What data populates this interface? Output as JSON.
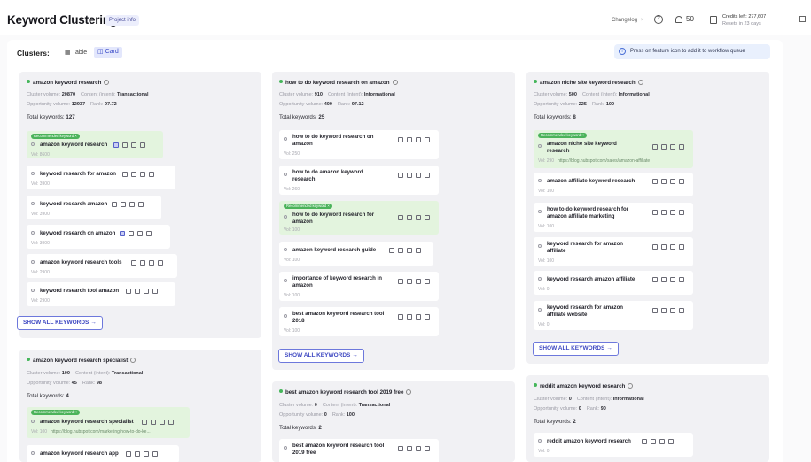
{
  "header": {
    "title": "Keyword Clustering",
    "project_chip": "Project info",
    "changelog": "Changelog",
    "changelog_close": "×",
    "notifications_count": "50",
    "credits_line": "Credits left: 277,607",
    "credits_reset": "Resets in 23 days"
  },
  "toolbar": {
    "clusters_label": "Clusters:",
    "view_table": "Table",
    "view_card": "Card",
    "info_banner": "Press on feature icon to add it to workflow queue"
  },
  "labels": {
    "cluster_volume": "Cluster volume:",
    "content_intent": "Content (intent):",
    "opportunity_volume": "Opportunity volume:",
    "rank": "Rank:",
    "total_keywords": "Total keywords:",
    "recommended": "Recommended keyword ×",
    "show_all": "SHOW ALL KEYWORDS →"
  },
  "clusters": [
    {
      "name": "amazon keyword research",
      "cluster_volume": "20870",
      "intent": "Transactional",
      "opportunity_volume": "12937",
      "rank": "97.72",
      "total": "127",
      "keywords": [
        {
          "name": "amazon keyword research",
          "vol": "Vol: 8600"
        },
        {
          "name": "keyword research for amazon",
          "vol": "Vol: 3900"
        },
        {
          "name": "keyword research amazon",
          "vol": "Vol: 3900"
        },
        {
          "name": "keyword research on amazon",
          "vol": "Vol: 3900"
        },
        {
          "name": "amazon keyword research tools",
          "vol": "Vol: 2900"
        },
        {
          "name": "keyword research tool amazon",
          "vol": "Vol: 2900"
        }
      ]
    },
    {
      "name": "how to do keyword research on amazon",
      "cluster_volume": "910",
      "intent": "Informational",
      "opportunity_volume": "409",
      "rank": "97.12",
      "total": "25",
      "keywords": [
        {
          "name": "how to do keyword research on amazon",
          "vol": "Vol: 250"
        },
        {
          "name": "how to do amazon keyword research",
          "vol": "Vol: 260"
        },
        {
          "name": "how to do keyword research for amazon",
          "vol": "Vol: 100"
        },
        {
          "name": "amazon keyword research guide",
          "vol": "Vol: 100"
        },
        {
          "name": "importance of keyword research in amazon",
          "vol": "Vol: 100"
        },
        {
          "name": "best amazon keyword research tool 2018",
          "vol": "Vol: 100"
        }
      ]
    },
    {
      "name": "amazon niche site keyword research",
      "cluster_volume": "500",
      "intent": "Informational",
      "opportunity_volume": "225",
      "rank": "100",
      "total": "8",
      "keywords": [
        {
          "name": "amazon niche site keyword research",
          "vol": "Vol: 290",
          "url": "https://blog.hubspot.com/sales/amazon-affiliate"
        },
        {
          "name": "amazon affiliate keyword research",
          "vol": "Vol: 100"
        },
        {
          "name": "how to do keyword research for amazon affiliate marketing",
          "vol": "Vol: 100"
        },
        {
          "name": "keyword research for amazon affiliate",
          "vol": "Vol: 100"
        },
        {
          "name": "keyword research amazon affiliate",
          "vol": "Vol: 0"
        },
        {
          "name": "keyword research for amazon affiliate website",
          "vol": "Vol: 0"
        }
      ]
    },
    {
      "name": "amazon keyword research specialist",
      "cluster_volume": "100",
      "intent": "Transactional",
      "opportunity_volume": "45",
      "rank": "98",
      "total": "4",
      "keywords": [
        {
          "name": "amazon keyword research specialist",
          "vol": "Vol: 100",
          "url": "https://blog.hubspot.com/marketing/how-to-do-ke..."
        },
        {
          "name": "amazon keyword research app",
          "vol": ""
        }
      ]
    },
    {
      "name": "best amazon keyword research tool 2019 free",
      "cluster_volume": "0",
      "intent": "Transactional",
      "opportunity_volume": "0",
      "rank": "100",
      "total": "2",
      "keywords": [
        {
          "name": "best amazon keyword research tool 2019 free",
          "vol": ""
        }
      ]
    },
    {
      "name": "reddit amazon keyword research",
      "cluster_volume": "0",
      "intent": "Informational",
      "opportunity_volume": "0",
      "rank": "90",
      "total": "2",
      "keywords": [
        {
          "name": "reddit amazon keyword research",
          "vol": "Vol: 0"
        }
      ]
    }
  ]
}
